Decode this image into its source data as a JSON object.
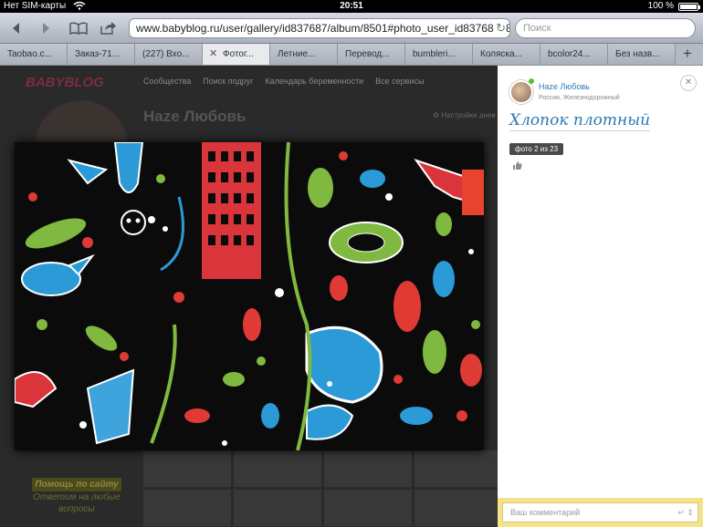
{
  "status_bar": {
    "carrier": "Нет SIM-карты",
    "time": "20:51",
    "battery": "100 %",
    "battery_level": 1.0
  },
  "toolbar": {
    "url": "www.babyblog.ru/user/gallery/id837687/album/8501#photo_user_id837687_85",
    "search_placeholder": "Поиск",
    "icons": [
      "back-icon",
      "forward-icon",
      "bookmarks-icon",
      "share-icon",
      "reload-icon"
    ]
  },
  "tabs": [
    {
      "label": "Taobao.c..."
    },
    {
      "label": "Заказ-71..."
    },
    {
      "label": "(227) Вхо..."
    },
    {
      "label": "Фотог...",
      "active": true
    },
    {
      "label": "Летние..."
    },
    {
      "label": "Перевод..."
    },
    {
      "label": "bumbleri..."
    },
    {
      "label": "Коляска..."
    },
    {
      "label": "bcolor24..."
    },
    {
      "label": "Без назв..."
    }
  ],
  "page": {
    "logo": "BABYBLOG",
    "nav": [
      "Сообщества",
      "Поиск подруг",
      "Календарь беременности",
      "Все сервисы"
    ],
    "user_name": "Haze Любовь",
    "settings_link": "Настройки днев",
    "promo": {
      "title": "Помощь по сайту",
      "text": "Ответим на любые вопросы"
    }
  },
  "panel": {
    "author_name": "Haze Любовь",
    "author_location": "Россия, Железнодорожный",
    "photo_title": "Хлопок плотный",
    "counter": "фото 2 из 23",
    "comment_placeholder": "Ваш комментарий",
    "colors": {
      "accent": "#2b78b4",
      "comment_bg": "#f5e28a"
    }
  }
}
